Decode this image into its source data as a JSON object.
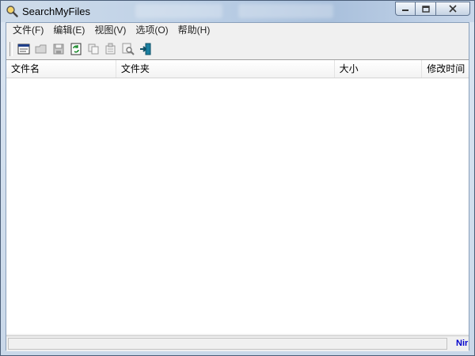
{
  "window": {
    "title": "SearchMyFiles"
  },
  "menubar": {
    "items": [
      "文件(F)",
      "编辑(E)",
      "视图(V)",
      "选项(O)",
      "帮助(H)"
    ]
  },
  "toolbar": {
    "buttons": [
      "new-search-icon",
      "open-icon",
      "save-icon",
      "refresh-icon",
      "copy-icon",
      "properties-icon",
      "find-icon",
      "exit-icon"
    ]
  },
  "list": {
    "columns": [
      "文件名",
      "文件夹",
      "大小",
      "修改时间"
    ]
  },
  "statusbar": {
    "link": "Nir"
  },
  "colors": {
    "accent": "#0000cc",
    "title_bar": "#bdd0e6"
  }
}
